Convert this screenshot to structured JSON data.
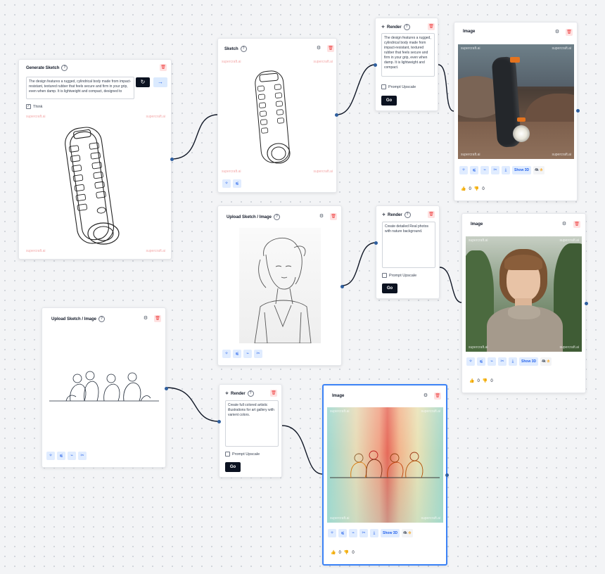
{
  "nodes": {
    "generate_sketch": {
      "title": "Generate Sketch",
      "prompt": "The design features a rugged, cylindrical body made from impact-resistant, textured rubber that feels secure and firm in your grip, even when damp. It is lightweight and compact, designed to",
      "think_label": "Think",
      "watermark": "supercraft.ai"
    },
    "sketch": {
      "title": "Sketch",
      "watermark": "supercraft.ai"
    },
    "render_top": {
      "title": "Render",
      "prompt": "The design features a rugged, cylindrical body made from impact-resistant, textured rubber that feels secure and firm in your grip, even when damp. It is lightweight and compact.",
      "upscale_label": "Prompt Upscale",
      "go_label": "Go"
    },
    "image_top": {
      "title": "Image",
      "watermark": "supercraft.ai",
      "show3d_label": "Show 3D",
      "resolution_label": "4k",
      "likes": "0",
      "dislikes": "0"
    },
    "upload_mid": {
      "title": "Upload Sketch / Image"
    },
    "render_mid": {
      "title": "Render",
      "prompt": "Create detailed Real photos with nature background.",
      "upscale_label": "Prompt Upscale",
      "go_label": "Go"
    },
    "image_mid": {
      "title": "Image",
      "watermark": "supercraft.ai",
      "show3d_label": "Show 3D",
      "resolution_label": "4k",
      "likes": "0",
      "dislikes": "0"
    },
    "upload_bottom": {
      "title": "Upload Sketch / Image"
    },
    "render_bottom": {
      "title": "Render",
      "prompt": "Create full colored artistic illustrations for art gallery with varient colors.",
      "upscale_label": "Prompt Upscale",
      "go_label": "Go"
    },
    "image_bottom": {
      "title": "Image",
      "watermark": "supercraft.ai",
      "show3d_label": "Show 3D",
      "resolution_label": "4k",
      "likes": "0",
      "dislikes": "0"
    }
  },
  "icons": {
    "help": "?",
    "gear": "⚙",
    "trash": "🗑",
    "regenerate": "↻",
    "arrow": "→",
    "sparkle": "✧",
    "wand": "⌁",
    "scissors": "✂",
    "download": "⤓",
    "like": "👍",
    "dislike": "👎"
  },
  "colors": {
    "accent": "#2563eb",
    "danger": "#ef4444",
    "dark_button": "#0b1220",
    "selected_border": "#3b82f6",
    "connector": "#111827"
  }
}
